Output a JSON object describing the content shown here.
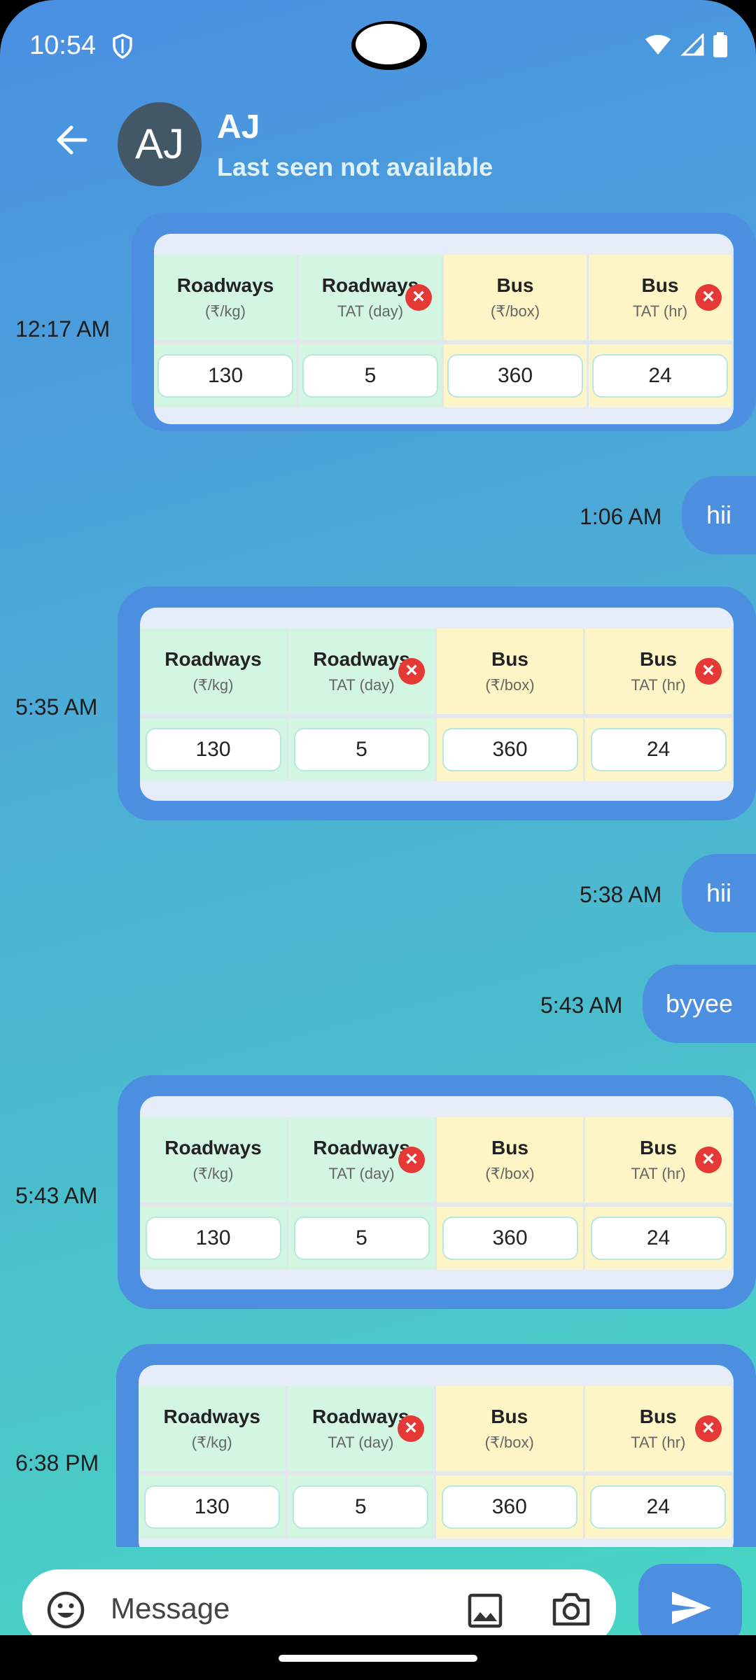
{
  "status": {
    "time": "10:54"
  },
  "contact": {
    "initials": "AJ",
    "name": "AJ",
    "last_seen": "Last seen not available"
  },
  "card_headers": [
    {
      "title": "Roadways",
      "sub": "(₹/kg)"
    },
    {
      "title": "Roadways",
      "sub": "TAT (day)"
    },
    {
      "title": "Bus",
      "sub": "(₹/box)"
    },
    {
      "title": "Bus",
      "sub": "TAT (hr)"
    }
  ],
  "messages": [
    {
      "type": "card",
      "time": "12:17 AM",
      "values": [
        "130",
        "5",
        "360",
        "24"
      ]
    },
    {
      "type": "text",
      "time": "1:06 AM",
      "text": "hii"
    },
    {
      "type": "card",
      "time": "5:35 AM",
      "values": [
        "130",
        "5",
        "360",
        "24"
      ]
    },
    {
      "type": "text",
      "time": "5:38 AM",
      "text": "hii"
    },
    {
      "type": "text",
      "time": "5:43 AM",
      "text": "byyee"
    },
    {
      "type": "card",
      "time": "5:43 AM",
      "values": [
        "130",
        "5",
        "360",
        "24"
      ]
    },
    {
      "type": "card",
      "time": "6:38 PM",
      "values": [
        "130",
        "5",
        "360",
        "24"
      ]
    }
  ],
  "composer": {
    "placeholder": "Message"
  },
  "colors": {
    "accent": "#4c8ee0",
    "green_cell": "#d3f6e3",
    "yellow_cell": "#fdf5c5",
    "remove": "#e53935"
  }
}
